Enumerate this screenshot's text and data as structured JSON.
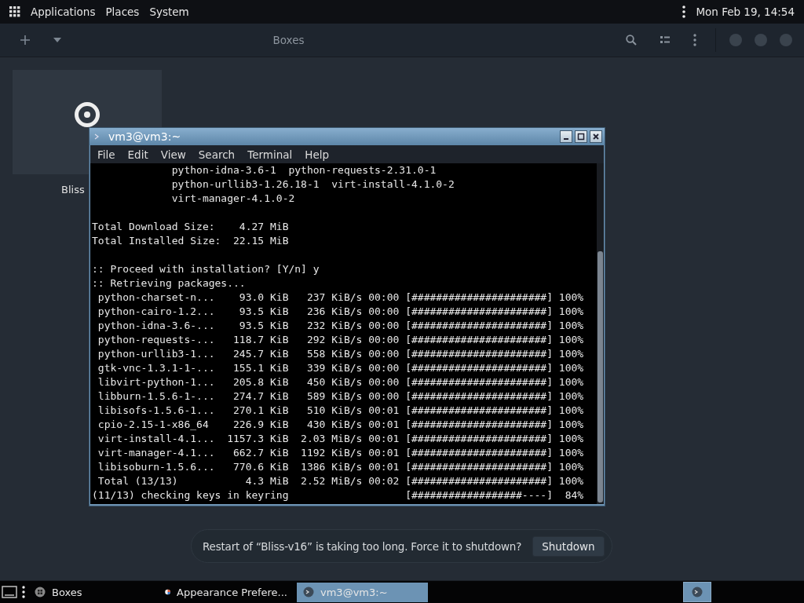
{
  "top_panel": {
    "menus": [
      "Applications",
      "Places",
      "System"
    ],
    "clock": "Mon Feb 19, 14:54"
  },
  "boxes": {
    "title": "Boxes",
    "machines": [
      {
        "label": "Bliss"
      }
    ]
  },
  "terminal": {
    "title": "vm3@vm3:~",
    "menu": [
      "File",
      "Edit",
      "View",
      "Search",
      "Terminal",
      "Help"
    ],
    "blocks": [
      [
        "             python-idna-3.6-1  python-requests-2.31.0-1",
        "             python-urllib3-1.26.18-1  virt-install-4.1.0-2",
        "             virt-manager-4.1.0-2"
      ],
      [
        "Total Download Size:    4.27 MiB",
        "Total Installed Size:  22.15 MiB"
      ],
      [
        ":: Proceed with installation? [Y/n] y",
        ":: Retrieving packages...",
        " python-charset-n...    93.0 KiB   237 KiB/s 00:00 [######################] 100%",
        " python-cairo-1.2...    93.5 KiB   236 KiB/s 00:00 [######################] 100%",
        " python-idna-3.6-...    93.5 KiB   232 KiB/s 00:00 [######################] 100%",
        " python-requests-...   118.7 KiB   292 KiB/s 00:00 [######################] 100%",
        " python-urllib3-1...   245.7 KiB   558 KiB/s 00:00 [######################] 100%",
        " gtk-vnc-1.3.1-1-...   155.1 KiB   339 KiB/s 00:00 [######################] 100%",
        " libvirt-python-1...   205.8 KiB   450 KiB/s 00:00 [######################] 100%",
        " libburn-1.5.6-1-...   274.7 KiB   589 KiB/s 00:00 [######################] 100%",
        " libisofs-1.5.6-1...   270.1 KiB   510 KiB/s 00:01 [######################] 100%",
        " cpio-2.15-1-x86_64    226.9 KiB   430 KiB/s 00:01 [######################] 100%",
        " virt-install-4.1...  1157.3 KiB  2.03 MiB/s 00:01 [######################] 100%",
        " virt-manager-4.1...   662.7 KiB  1192 KiB/s 00:01 [######################] 100%",
        " libisoburn-1.5.6...   770.6 KiB  1386 KiB/s 00:01 [######################] 100%",
        " Total (13/13)           4.3 MiB  2.52 MiB/s 00:02 [######################] 100%",
        "(11/13) checking keys in keyring                   [##################----]  84%"
      ]
    ]
  },
  "notification": {
    "message": "Restart of “Bliss-v16” is taking too long. Force it to shutdown?",
    "button": "Shutdown"
  },
  "taskbar": {
    "items": [
      {
        "kind": "boxes",
        "label": "Boxes",
        "selected": false
      },
      {
        "kind": "appearance",
        "label": "Appearance Prefere...",
        "selected": false
      },
      {
        "kind": "terminal",
        "label": "vm3@vm3:~",
        "selected": true
      }
    ]
  }
}
